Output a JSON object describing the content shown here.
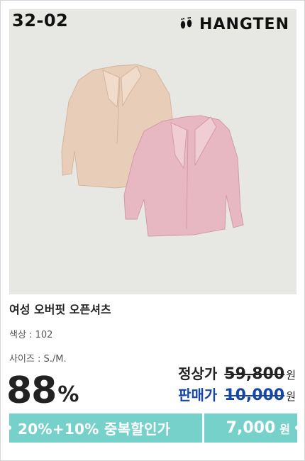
{
  "product": {
    "code": "32-02",
    "brand": "HANGTEN",
    "brand_icon": "footprints-icon",
    "title": "여성 오버핏 오픈셔츠",
    "color_label": "색상",
    "color_value": "102",
    "size_label": "사이즈",
    "size_value": "S./M."
  },
  "pricing": {
    "discount_value": "88",
    "discount_unit": "%",
    "regular_label": "정상가",
    "regular_price": "59,800",
    "sale_label": "판매가",
    "sale_price": "10,000",
    "currency": "원",
    "final_price": "7,000"
  },
  "banner": {
    "text": "20%+10% 중복할인가"
  },
  "colors": {
    "photo_bg": "#e7e7e3",
    "banner": "#77d1cb",
    "sale_blue": "#1747a6",
    "beige_shirt": "#e8cdb8",
    "pink_shirt": "#e7b8c2"
  }
}
